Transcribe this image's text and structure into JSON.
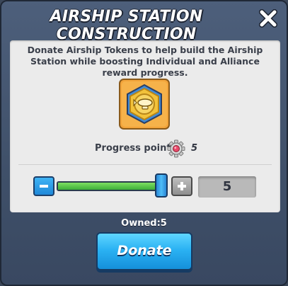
{
  "dialog": {
    "title": "AIRSHIP STATION CONSTRUCTION",
    "close_icon": "close-icon"
  },
  "panel": {
    "description": "Donate Airship Tokens to help build the Airship Station while boosting Individual and Alliance reward progress.",
    "token_icon": "airship-token-icon",
    "progress_label": "Progress points:",
    "progress_icon": "gear-points-icon",
    "progress_value": "5"
  },
  "slider": {
    "minus_icon": "minus-icon",
    "plus_icon": "plus-icon",
    "fill_fraction": 1.0,
    "amount": "5"
  },
  "owned": {
    "label": "Owned:",
    "value": "5"
  },
  "donate_button": {
    "label": "Donate"
  },
  "colors": {
    "accent_blue": "#2bb2f3",
    "slider_green": "#4fc44a",
    "token_orange": "#f3a43a"
  }
}
